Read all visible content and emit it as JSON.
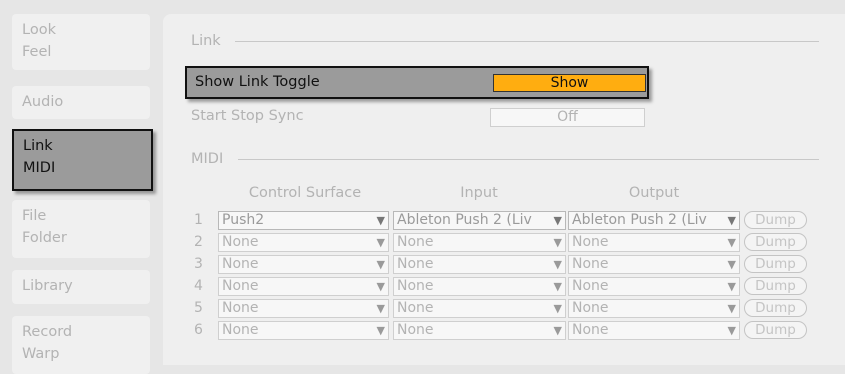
{
  "sidebar": {
    "tabs": [
      {
        "lines": [
          "Look",
          "Feel"
        ],
        "active": false
      },
      {
        "lines": [
          "Audio"
        ],
        "active": false
      },
      {
        "lines": [
          "Link",
          "MIDI"
        ],
        "active": true
      },
      {
        "lines": [
          "File",
          "Folder"
        ],
        "active": false
      },
      {
        "lines": [
          "Library"
        ],
        "active": false
      },
      {
        "lines": [
          "Record",
          "Warp"
        ],
        "active": false
      }
    ]
  },
  "link_section": {
    "title": "Link",
    "show_link_toggle": {
      "label": "Show Link Toggle",
      "value": "Show"
    },
    "start_stop_sync": {
      "label": "Start Stop Sync",
      "value": "Off"
    }
  },
  "midi_section": {
    "title": "MIDI",
    "columns": {
      "control_surface": "Control Surface",
      "input": "Input",
      "output": "Output"
    },
    "dump_label": "Dump",
    "rows": [
      {
        "num": "1",
        "surface": "Push2",
        "input": "Ableton Push 2 (Liv",
        "output": "Ableton Push 2 (Liv"
      },
      {
        "num": "2",
        "surface": "None",
        "input": "None",
        "output": "None"
      },
      {
        "num": "3",
        "surface": "None",
        "input": "None",
        "output": "None"
      },
      {
        "num": "4",
        "surface": "None",
        "input": "None",
        "output": "None"
      },
      {
        "num": "5",
        "surface": "None",
        "input": "None",
        "output": "None"
      },
      {
        "num": "6",
        "surface": "None",
        "input": "None",
        "output": "None"
      }
    ]
  },
  "colors": {
    "accent": "#ffad10",
    "highlight": "#9b9b9b",
    "panel": "#efefef"
  },
  "icons": {
    "dropdown": "triangle-down-icon"
  }
}
